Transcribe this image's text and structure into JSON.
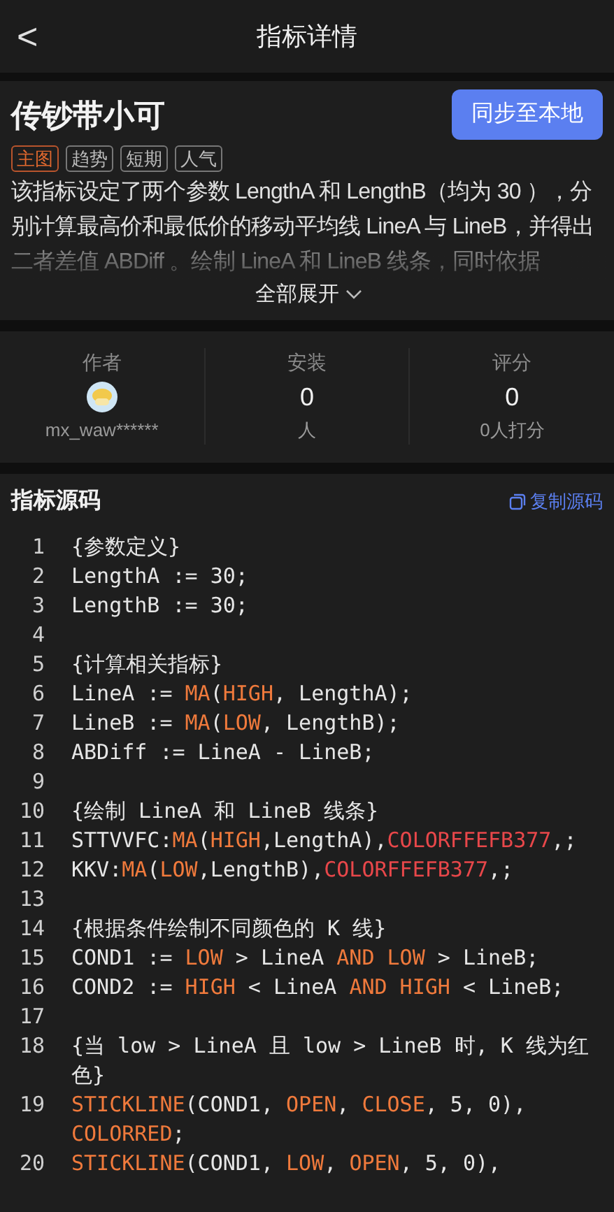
{
  "header": {
    "back": "<",
    "title": "指标详情"
  },
  "indicator": {
    "name": "传钞带小可",
    "sync_button": "同步至本地",
    "tags": [
      {
        "label": "主图",
        "selected": true
      },
      {
        "label": "趋势",
        "selected": false
      },
      {
        "label": "短期",
        "selected": false
      },
      {
        "label": "人气",
        "selected": false
      }
    ],
    "description": "该指标设定了两个参数 LengthA 和 LengthB（均为 30 ），分别计算最高价和最低价的移动平均线 LineA 与 LineB，并得出二者差值 ABDiff 。绘制 LineA 和 LineB 线条，同时依据",
    "expand": "全部展开"
  },
  "stats": [
    {
      "label": "作者",
      "kind": "author",
      "value": "mx_waw******"
    },
    {
      "label": "安装",
      "kind": "number",
      "value": "0",
      "unit": "人"
    },
    {
      "label": "评分",
      "kind": "number",
      "value": "0",
      "unit": "0人打分"
    }
  ],
  "source": {
    "title": "指标源码",
    "copy_button": "复制源码",
    "lines": [
      {
        "number": "1",
        "segments": [
          {
            "text": "{参数定义}",
            "kind": "plain"
          }
        ]
      },
      {
        "number": "2",
        "segments": [
          {
            "text": "LengthA := 30;",
            "kind": "plain"
          }
        ]
      },
      {
        "number": "3",
        "segments": [
          {
            "text": "LengthB := 30;",
            "kind": "plain"
          }
        ]
      },
      {
        "number": "4"
      },
      {
        "number": "5",
        "segments": [
          {
            "text": "{计算相关指标}",
            "kind": "plain"
          }
        ]
      },
      {
        "number": "6",
        "segments": [
          {
            "text": "LineA := ",
            "kind": "plain"
          },
          {
            "text": "MA",
            "kind": "keyword"
          },
          {
            "text": "(",
            "kind": "plain"
          },
          {
            "text": "HIGH",
            "kind": "keyword"
          },
          {
            "text": ", LengthA);",
            "kind": "plain"
          }
        ]
      },
      {
        "number": "7",
        "segments": [
          {
            "text": "LineB := ",
            "kind": "plain"
          },
          {
            "text": "MA",
            "kind": "keyword"
          },
          {
            "text": "(",
            "kind": "plain"
          },
          {
            "text": "LOW",
            "kind": "keyword"
          },
          {
            "text": ", LengthB);",
            "kind": "plain"
          }
        ]
      },
      {
        "number": "8",
        "segments": [
          {
            "text": "ABDiff := LineA - LineB;",
            "kind": "plain"
          }
        ]
      },
      {
        "number": "9"
      },
      {
        "number": "10",
        "segments": [
          {
            "text": "{绘制 LineA 和 LineB 线条}",
            "kind": "plain"
          }
        ]
      },
      {
        "number": "11",
        "segments": [
          {
            "text": "STTVVFC:",
            "kind": "plain"
          },
          {
            "text": "MA",
            "kind": "keyword"
          },
          {
            "text": "(",
            "kind": "plain"
          },
          {
            "text": "HIGH",
            "kind": "keyword"
          },
          {
            "text": ",LengthA),",
            "kind": "plain"
          },
          {
            "text": "COLORFFEFB377",
            "kind": "color"
          },
          {
            "text": ",;",
            "kind": "plain"
          }
        ]
      },
      {
        "number": "12",
        "segments": [
          {
            "text": "KKV:",
            "kind": "plain"
          },
          {
            "text": "MA",
            "kind": "keyword"
          },
          {
            "text": "(",
            "kind": "plain"
          },
          {
            "text": "LOW",
            "kind": "keyword"
          },
          {
            "text": ",LengthB),",
            "kind": "plain"
          },
          {
            "text": "COLORFFEFB377",
            "kind": "color"
          },
          {
            "text": ",;",
            "kind": "plain"
          }
        ]
      },
      {
        "number": "13"
      },
      {
        "number": "14",
        "segments": [
          {
            "text": "{根据条件绘制不同颜色的 K 线}",
            "kind": "plain"
          }
        ]
      },
      {
        "number": "15",
        "segments": [
          {
            "text": "COND1 := ",
            "kind": "plain"
          },
          {
            "text": "LOW",
            "kind": "keyword"
          },
          {
            "text": " > LineA ",
            "kind": "plain"
          },
          {
            "text": "AND LOW",
            "kind": "keyword"
          },
          {
            "text": " > LineB;",
            "kind": "plain"
          }
        ]
      },
      {
        "number": "16",
        "segments": [
          {
            "text": "COND2 := ",
            "kind": "plain"
          },
          {
            "text": "HIGH",
            "kind": "keyword"
          },
          {
            "text": " < LineA ",
            "kind": "plain"
          },
          {
            "text": "AND HIGH",
            "kind": "keyword"
          },
          {
            "text": " < LineB;",
            "kind": "plain"
          }
        ]
      },
      {
        "number": "17"
      },
      {
        "number": "18",
        "segments": [
          {
            "text": "{当 low > LineA 且 low > LineB 时, K 线为红色}",
            "kind": "plain"
          }
        ]
      },
      {
        "number": "19",
        "segments": [
          {
            "text": "STICKLINE",
            "kind": "keyword"
          },
          {
            "text": "(COND1, ",
            "kind": "plain"
          },
          {
            "text": "OPEN",
            "kind": "keyword"
          },
          {
            "text": ", ",
            "kind": "plain"
          },
          {
            "text": "CLOSE",
            "kind": "keyword"
          },
          {
            "text": ", 5, 0), ",
            "kind": "plain"
          },
          {
            "text": "COLORRED",
            "kind": "keyword"
          },
          {
            "text": ";",
            "kind": "plain"
          }
        ]
      },
      {
        "number": "20",
        "segments": [
          {
            "text": "STICKLINE",
            "kind": "keyword"
          },
          {
            "text": "(COND1, ",
            "kind": "plain"
          },
          {
            "text": "LOW",
            "kind": "keyword"
          },
          {
            "text": ", ",
            "kind": "plain"
          },
          {
            "text": "OPEN",
            "kind": "keyword"
          },
          {
            "text": ", 5, 0),",
            "kind": "plain"
          }
        ]
      }
    ]
  }
}
